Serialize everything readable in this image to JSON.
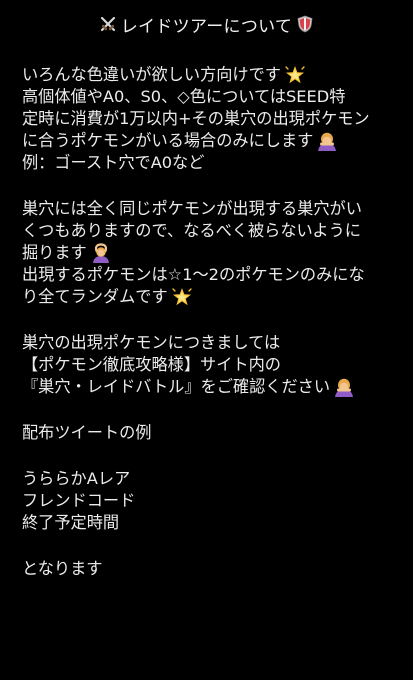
{
  "title": {
    "text": "レイドツアーについて",
    "left_icon": "crossed-swords-icon",
    "right_icon": "shield-icon"
  },
  "paragraphs": [
    {
      "lines": [
        {
          "text": "いろんな色違いが欲しい方向けです",
          "icon": "glowing-star-icon"
        },
        {
          "text": "高個体値やA0、S0、◇色についてはSEED特"
        },
        {
          "text": "定時に消費が1万以内+その巣穴の出現ポケモン"
        },
        {
          "text": "に合うポケモンがいる場合のみにします",
          "icon": "bowing-person-icon"
        },
        {
          "text": "例：ゴースト穴でA0など"
        }
      ]
    },
    {
      "lines": [
        {
          "text": "巣穴には全く同じポケモンが出現する巣穴がい"
        },
        {
          "text": "くつもありますので、なるべく被らないように"
        },
        {
          "text": "掘ります",
          "icon": "person-gesturing-ok-icon"
        },
        {
          "text": "出現するポケモンは☆1〜2のポケモンのみにな"
        },
        {
          "text": "り全てランダムです",
          "icon": "glowing-star-icon"
        }
      ]
    },
    {
      "lines": [
        {
          "text": "巣穴の出現ポケモンにつきましては"
        },
        {
          "text": "【ポケモン徹底攻略様】サイト内の"
        },
        {
          "text": "『巣穴・レイドバトル』をご確認ください",
          "icon": "bowing-person-icon"
        }
      ]
    },
    {
      "lines": [
        {
          "text": "配布ツイートの例"
        }
      ]
    },
    {
      "lines": [
        {
          "text": "うららかAレア"
        },
        {
          "text": "フレンドコード"
        },
        {
          "text": "終了予定時間"
        }
      ]
    },
    {
      "lines": [
        {
          "text": "となります"
        }
      ]
    }
  ]
}
